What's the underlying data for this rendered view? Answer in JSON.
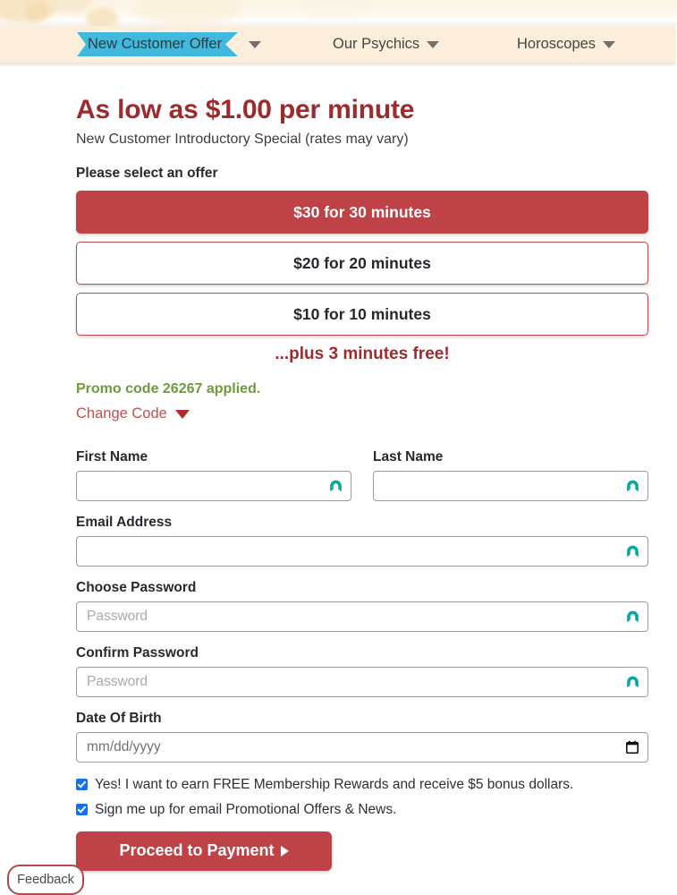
{
  "nav": {
    "items": [
      {
        "label": "New Customer Offer",
        "active": true,
        "icon": "chevron-down-icon"
      },
      {
        "label": "Our Psychics",
        "active": false,
        "icon": "chevron-down-icon"
      },
      {
        "label": "Horoscopes",
        "active": false,
        "icon": "chevron-down-icon"
      }
    ],
    "active_tab_color": "#40b9dd",
    "bar_color": "#fceedb"
  },
  "hero": {
    "headline": "As low as $1.00 per minute",
    "subline": "New Customer Introductory Special (rates may vary)",
    "select_prompt": "Please select an offer",
    "headline_color": "#9c2b2e"
  },
  "offers": {
    "items": [
      {
        "label": "$30 for 30 minutes",
        "selected": true
      },
      {
        "label": "$20 for 20 minutes",
        "selected": false
      },
      {
        "label": "$10 for 10 minutes",
        "selected": false
      }
    ],
    "bonus_text": "...plus 3 minutes free!",
    "selected_color": "#bf4247"
  },
  "promo": {
    "applied_text": "Promo code 26267 applied.",
    "applied_color": "#6d9b3f",
    "change_label": "Change Code",
    "change_icon": "caret-down-icon"
  },
  "form": {
    "first_name": {
      "label": "First Name",
      "value": "",
      "placeholder": "",
      "icon": "nordpass-icon"
    },
    "last_name": {
      "label": "Last Name",
      "value": "",
      "placeholder": "",
      "icon": "nordpass-icon"
    },
    "email": {
      "label": "Email Address",
      "value": "",
      "placeholder": "",
      "icon": "nordpass-icon"
    },
    "password": {
      "label": "Choose Password",
      "value": "",
      "placeholder": "Password",
      "icon": "nordpass-icon"
    },
    "confirm": {
      "label": "Confirm Password",
      "value": "",
      "placeholder": "Password",
      "icon": "nordpass-icon"
    },
    "dob": {
      "label": "Date Of Birth",
      "value": "",
      "placeholder": "mm/dd/yyyy",
      "icon": "calendar-icon"
    }
  },
  "consents": [
    {
      "label": "Yes! I want to earn FREE Membership Rewards and receive $5 bonus dollars.",
      "checked": true
    },
    {
      "label": "Sign me up for email Promotional Offers & News.",
      "checked": true
    }
  ],
  "actions": {
    "proceed_label": "Proceed to Payment",
    "proceed_icon": "arrow-right-icon",
    "feedback_label": "Feedback"
  }
}
